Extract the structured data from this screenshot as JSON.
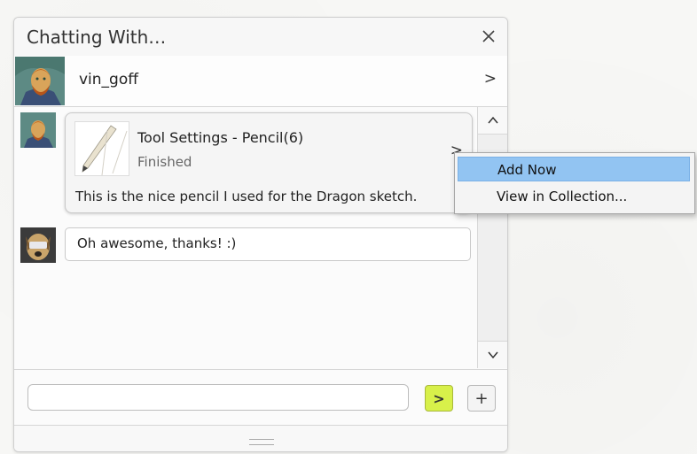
{
  "window": {
    "title": "Chatting With…",
    "close_icon": "close-icon"
  },
  "contact": {
    "name": "vin_goff",
    "chevron": ">"
  },
  "messages": [
    {
      "type": "tool_settings",
      "title": "Tool Settings - Pencil(6)",
      "status": "Finished",
      "chevron": ">",
      "description": "This is the nice pencil I used for the Dragon sketch."
    },
    {
      "type": "text",
      "text": "Oh awesome, thanks! :)"
    }
  ],
  "scrollbar": {
    "up": "^",
    "down": "v"
  },
  "composer": {
    "value": "",
    "placeholder": "",
    "send_label": ">",
    "add_label": "+"
  },
  "context_menu": {
    "items": [
      {
        "label": "Add Now",
        "selected": true
      },
      {
        "label": "View in Collection...",
        "selected": false
      }
    ]
  },
  "colors": {
    "send_button": "#d8f04a",
    "menu_highlight": "#92c4f2"
  }
}
